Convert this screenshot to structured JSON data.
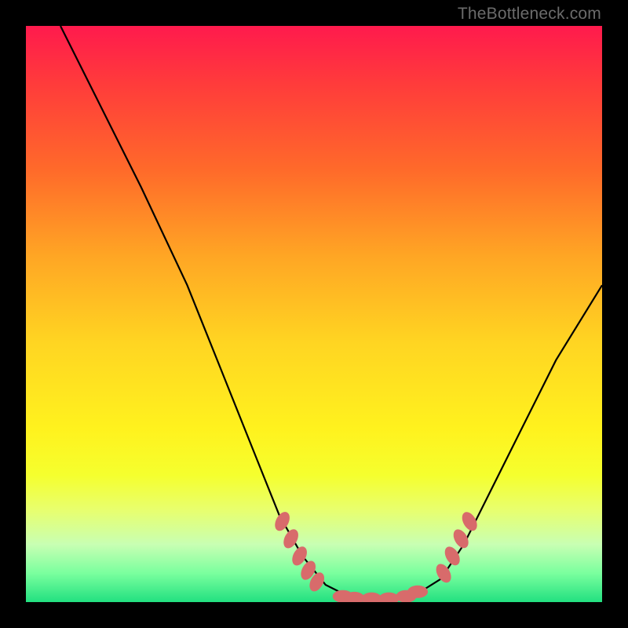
{
  "watermark": "TheBottleneck.com",
  "chart_data": {
    "type": "line",
    "title": "",
    "xlabel": "",
    "ylabel": "",
    "xlim": [
      0,
      100
    ],
    "ylim": [
      0,
      100
    ],
    "curve": [
      {
        "x": 6,
        "y": 100
      },
      {
        "x": 12,
        "y": 88
      },
      {
        "x": 20,
        "y": 72
      },
      {
        "x": 28,
        "y": 55
      },
      {
        "x": 34,
        "y": 40
      },
      {
        "x": 40,
        "y": 25
      },
      {
        "x": 44,
        "y": 15
      },
      {
        "x": 48,
        "y": 8
      },
      {
        "x": 52,
        "y": 3
      },
      {
        "x": 56,
        "y": 1
      },
      {
        "x": 60,
        "y": 0.5
      },
      {
        "x": 64,
        "y": 0.5
      },
      {
        "x": 68,
        "y": 1.5
      },
      {
        "x": 72,
        "y": 4
      },
      {
        "x": 76,
        "y": 10
      },
      {
        "x": 80,
        "y": 18
      },
      {
        "x": 86,
        "y": 30
      },
      {
        "x": 92,
        "y": 42
      },
      {
        "x": 100,
        "y": 55
      }
    ],
    "highlight_points": [
      {
        "x": 44.5,
        "y": 14
      },
      {
        "x": 46,
        "y": 11
      },
      {
        "x": 47.5,
        "y": 8
      },
      {
        "x": 49,
        "y": 5.5
      },
      {
        "x": 50.5,
        "y": 3.5
      },
      {
        "x": 55,
        "y": 1
      },
      {
        "x": 57,
        "y": 0.7
      },
      {
        "x": 60,
        "y": 0.6
      },
      {
        "x": 63,
        "y": 0.6
      },
      {
        "x": 66,
        "y": 1
      },
      {
        "x": 68,
        "y": 1.8
      },
      {
        "x": 72.5,
        "y": 5
      },
      {
        "x": 74,
        "y": 8
      },
      {
        "x": 75.5,
        "y": 11
      },
      {
        "x": 77,
        "y": 14
      }
    ],
    "highlight_color": "#d86b6b"
  }
}
